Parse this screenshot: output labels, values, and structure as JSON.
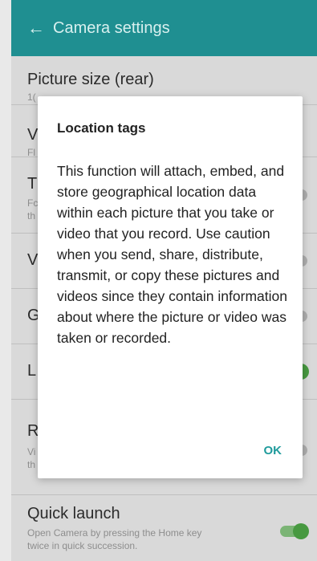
{
  "appbar": {
    "title": "Camera settings"
  },
  "settings": {
    "picture_size": {
      "title": "Picture size (rear)",
      "sub_fragment": "1("
    },
    "item2": {
      "title_fragment": "V",
      "sub_fragment": "Fl"
    },
    "item3": {
      "title_fragment": "T",
      "sub_line1": "Fc",
      "sub_line2": "th"
    },
    "item4": {
      "title_fragment": "V"
    },
    "item5": {
      "title_fragment": "G"
    },
    "item6": {
      "title_fragment": "L"
    },
    "item7": {
      "title_fragment": "R",
      "sub_line1": "Vi",
      "sub_line2": "th"
    },
    "quick_launch": {
      "title": "Quick launch",
      "sub_line1": "Open Camera by pressing the Home key",
      "sub_line2": "twice in quick succession."
    }
  },
  "toggles": {
    "item3": "off",
    "item4": "off",
    "item5": "off",
    "item6": "on",
    "item7": "off",
    "quick_launch": "on"
  },
  "dialog": {
    "title": "Location tags",
    "body": "This function will attach, embed, and store geographical location data within each picture that you take or video that you record. Use caution when you send, share, distribute, transmit, or copy these pictures and videos since they contain information about where the picture or video was taken or recorded.",
    "ok_label": "OK"
  },
  "colors": {
    "appbar": "#1f8f91",
    "accent": "#1f9b9c",
    "toggle_on": "#4ea746"
  }
}
